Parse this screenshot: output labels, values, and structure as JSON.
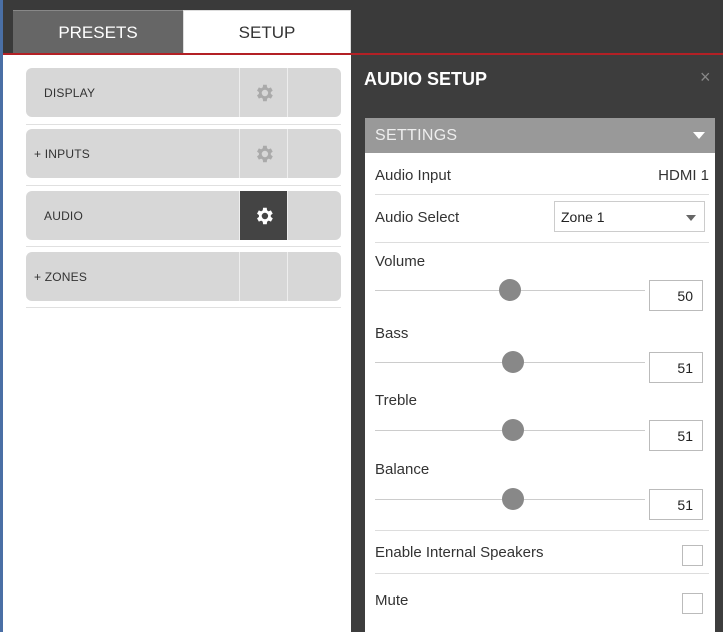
{
  "tabs": {
    "presets": "PRESETS",
    "setup": "SETUP"
  },
  "menu": {
    "display": "DISPLAY",
    "inputs": "+ INPUTS",
    "audio": "AUDIO",
    "zones": "+ ZONES"
  },
  "panel": {
    "title": "AUDIO SETUP",
    "close": "×",
    "section": "SETTINGS"
  },
  "audio": {
    "input_label": "Audio Input",
    "input_value": "HDMI 1",
    "select_label": "Audio Select",
    "select_value": "Zone 1",
    "volume_label": "Volume",
    "volume_value": "50",
    "bass_label": "Bass",
    "bass_value": "51",
    "treble_label": "Treble",
    "treble_value": "51",
    "balance_label": "Balance",
    "balance_value": "51",
    "speakers_label": "Enable Internal Speakers",
    "mute_label": "Mute"
  },
  "colors": {
    "accent_red": "#b32025",
    "active_gear_bg": "#444444"
  },
  "icons": {
    "menu_gear": "gear-icon"
  }
}
